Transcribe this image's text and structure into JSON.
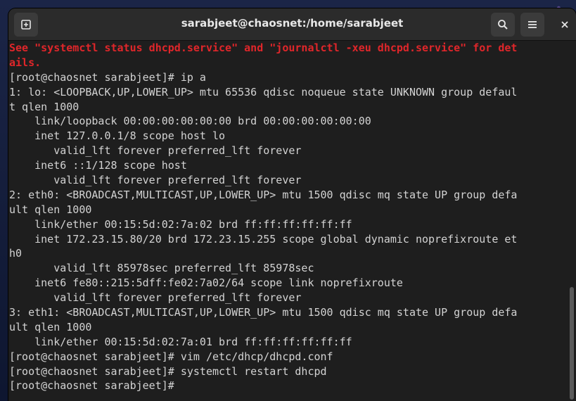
{
  "window": {
    "title": "sarabjeet@chaosnet:/home/sarabjeet"
  },
  "toolbar": {
    "new_tab_icon": "new-tab-icon",
    "search_icon": "search-icon",
    "menu_icon": "hamburger-menu-icon",
    "close_icon": "close-icon"
  },
  "terminal": {
    "lines": [
      {
        "text": "See \"systemctl status dhcpd.service\" and \"journalctl -xeu dhcpd.service\" for det",
        "style": "error"
      },
      {
        "text": "ails.",
        "style": "error"
      },
      {
        "text": "[root@chaosnet sarabjeet]# ip a",
        "style": "normal"
      },
      {
        "text": "1: lo: <LOOPBACK,UP,LOWER_UP> mtu 65536 qdisc noqueue state UNKNOWN group defaul",
        "style": "normal"
      },
      {
        "text": "t qlen 1000",
        "style": "normal"
      },
      {
        "text": "    link/loopback 00:00:00:00:00:00 brd 00:00:00:00:00:00",
        "style": "normal"
      },
      {
        "text": "    inet 127.0.0.1/8 scope host lo",
        "style": "normal"
      },
      {
        "text": "       valid_lft forever preferred_lft forever",
        "style": "normal"
      },
      {
        "text": "    inet6 ::1/128 scope host",
        "style": "normal"
      },
      {
        "text": "       valid_lft forever preferred_lft forever",
        "style": "normal"
      },
      {
        "text": "2: eth0: <BROADCAST,MULTICAST,UP,LOWER_UP> mtu 1500 qdisc mq state UP group defa",
        "style": "normal"
      },
      {
        "text": "ult qlen 1000",
        "style": "normal"
      },
      {
        "text": "    link/ether 00:15:5d:02:7a:02 brd ff:ff:ff:ff:ff:ff",
        "style": "normal"
      },
      {
        "text": "    inet 172.23.15.80/20 brd 172.23.15.255 scope global dynamic noprefixroute et",
        "style": "normal"
      },
      {
        "text": "h0",
        "style": "normal"
      },
      {
        "text": "       valid_lft 85978sec preferred_lft 85978sec",
        "style": "normal"
      },
      {
        "text": "    inet6 fe80::215:5dff:fe02:7a02/64 scope link noprefixroute",
        "style": "normal"
      },
      {
        "text": "       valid_lft forever preferred_lft forever",
        "style": "normal"
      },
      {
        "text": "3: eth1: <BROADCAST,MULTICAST,UP,LOWER_UP> mtu 1500 qdisc mq state UP group defa",
        "style": "normal"
      },
      {
        "text": "ult qlen 1000",
        "style": "normal"
      },
      {
        "text": "    link/ether 00:15:5d:02:7a:01 brd ff:ff:ff:ff:ff:ff",
        "style": "normal"
      },
      {
        "text": "[root@chaosnet sarabjeet]# vim /etc/dhcp/dhcpd.conf",
        "style": "normal"
      },
      {
        "text": "[root@chaosnet sarabjeet]# systemctl restart dhcpd",
        "style": "normal"
      },
      {
        "text": "[root@chaosnet sarabjeet]# ",
        "style": "normal"
      }
    ]
  },
  "colors": {
    "terminal_bg": "#1e1e1e",
    "terminal_fg": "#d3d3d3",
    "error_fg": "#e0262a",
    "titlebar_bg": "#2b2b2b"
  }
}
